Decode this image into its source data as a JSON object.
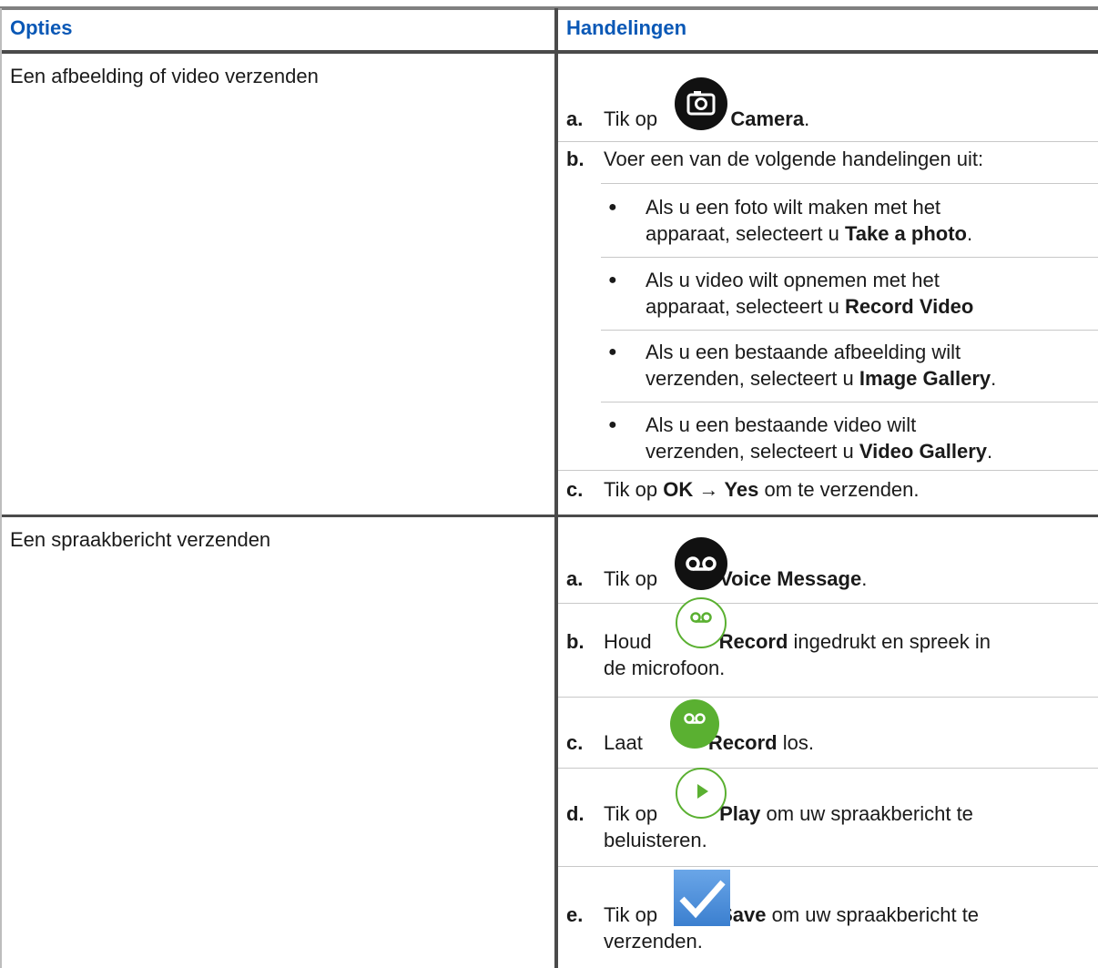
{
  "header": {
    "col1": "Opties",
    "col2": "Handelingen"
  },
  "rows": [
    {
      "option": "Een afbeelding of video verzenden",
      "steps": {
        "a": {
          "label": "a.",
          "pre": "Tik op",
          "bold": "Camera",
          "post": "."
        },
        "b": {
          "label": "b.",
          "text": "Voer een van de volgende handelingen uit:"
        },
        "bullets": [
          {
            "l1": "Als u een foto wilt maken met het",
            "l2": "apparaat, selecteert u",
            "bold": "Take a photo",
            "post": "."
          },
          {
            "l1": "Als u video wilt opnemen met het",
            "l2": "apparaat, selecteert u",
            "bold": "Record Video",
            "post": ""
          },
          {
            "l1": "Als u een bestaande afbeelding wilt",
            "l2": "verzenden, selecteert u",
            "bold": "Image Gallery",
            "post": "."
          },
          {
            "l1": "Als u een bestaande video wilt",
            "l2": "verzenden, selecteert u",
            "bold": "Video Gallery",
            "post": "."
          }
        ],
        "c": {
          "label": "c.",
          "pre": "Tik op",
          "bold1": "OK",
          "arrow": "→",
          "bold2": "Yes",
          "post": "om te verzenden."
        }
      }
    },
    {
      "option": "Een spraakbericht verzenden",
      "steps": {
        "a": {
          "label": "a.",
          "pre": "Tik op",
          "bold": "Voice Message",
          "post": "."
        },
        "b": {
          "label": "b.",
          "pre": "Houd",
          "bold": "Record",
          "post": "ingedrukt en spreek in",
          "l2": "de microfoon."
        },
        "c": {
          "label": "c.",
          "pre": "Laat",
          "bold": "Record",
          "post": "los."
        },
        "d": {
          "label": "d.",
          "pre": "Tik op",
          "bold": "Play",
          "post": "om uw spraakbericht te",
          "l2": "beluisteren."
        },
        "e": {
          "label": "e.",
          "pre": "Tik op",
          "bold": "Save",
          "post": "om uw spraakbericht te",
          "l2": "verzenden."
        }
      }
    }
  ],
  "icons": {
    "camera": "camera-icon",
    "voicemail_black": "voicemail-icon",
    "record_outline": "record-outline-icon",
    "record_green": "record-green-icon",
    "play": "play-icon",
    "save": "checkmark-icon"
  },
  "colors": {
    "header_text": "#0a58b6",
    "green": "#5ab031",
    "check_bg": "#4a8fdb"
  }
}
